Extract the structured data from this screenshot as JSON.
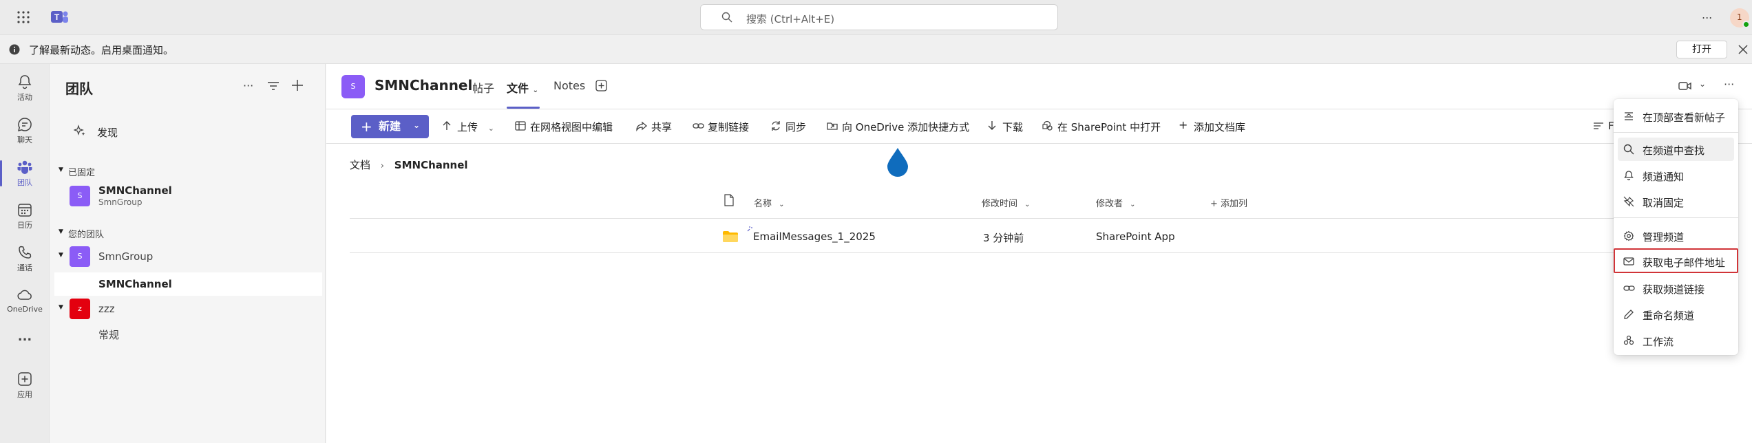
{
  "topbar": {
    "search_placeholder": "搜索 (Ctrl+Alt+E)",
    "more_label": "...",
    "profile_initial": "1"
  },
  "notification": {
    "message": "了解最新动态。启用桌面通知。",
    "open_label": "打开"
  },
  "rail": {
    "items": [
      {
        "label": "活动",
        "icon": "bell-icon"
      },
      {
        "label": "聊天",
        "icon": "chat-icon"
      },
      {
        "label": "团队",
        "icon": "teams-icon"
      },
      {
        "label": "日历",
        "icon": "calendar-icon"
      },
      {
        "label": "通话",
        "icon": "phone-icon"
      },
      {
        "label": "OneDrive",
        "icon": "cloud-icon"
      },
      {
        "label": "...",
        "icon": "more-icon"
      },
      {
        "label": "应用",
        "icon": "apps-icon"
      }
    ]
  },
  "teams_panel": {
    "title": "团队",
    "discover": "发现",
    "pinned_label": "已固定",
    "pinned": {
      "name": "SMNChannel",
      "team": "SmnGroup",
      "avatar": "S"
    },
    "your_teams_label": "您的团队",
    "teams": [
      {
        "name": "SmnGroup",
        "avatar": "S",
        "color": "#8b5cf6",
        "channels": [
          "SMNChannel"
        ]
      },
      {
        "name": "zzz",
        "avatar": "z",
        "color": "#e3000f",
        "channels": [
          "常规"
        ]
      }
    ]
  },
  "channel": {
    "avatar": "S",
    "name": "SMNChannel",
    "tabs": [
      "帖子",
      "文件",
      "Notes"
    ],
    "active_tab": "文件"
  },
  "commands": {
    "new": "新建",
    "upload": "上传",
    "grid_edit": "在网格视图中编辑",
    "share": "共享",
    "copy_link": "复制链接",
    "sync": "同步",
    "add_shortcut": "向 OneDrive 添加快捷方式",
    "download": "下载",
    "open_sharepoint": "在 SharePoint 中打开",
    "add_library": "添加文档库",
    "truncated": "F"
  },
  "breadcrumb": {
    "root": "文档",
    "current": "SMNChannel"
  },
  "table": {
    "headers": {
      "name": "名称",
      "modified": "修改时间",
      "modified_by": "修改者",
      "add_column": "+ 添加列"
    },
    "rows": [
      {
        "name": "EmailMessages_1_2025",
        "modified": "3 分钟前",
        "modified_by": "SharePoint App"
      }
    ]
  },
  "menu": {
    "items": [
      {
        "label": "在顶部查看新帖子",
        "icon": "posts-top-icon"
      },
      {
        "label": "在频道中查找",
        "icon": "search-icon"
      },
      {
        "label": "频道通知",
        "icon": "bell-icon"
      },
      {
        "label": "取消固定",
        "icon": "unpin-icon"
      },
      {
        "label": "管理频道",
        "icon": "gear-icon"
      },
      {
        "label": "获取电子邮件地址",
        "icon": "mail-icon"
      },
      {
        "label": "获取频道链接",
        "icon": "link-icon"
      },
      {
        "label": "重命名频道",
        "icon": "pencil-icon"
      },
      {
        "label": "工作流",
        "icon": "workflow-icon"
      }
    ]
  },
  "colors": {
    "brand": "#5b5fc7",
    "highlight": "#d13438",
    "presence": "#13a10e"
  }
}
